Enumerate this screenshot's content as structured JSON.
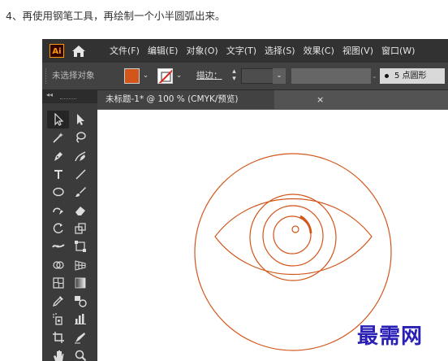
{
  "caption": "4、再使用钢笔工具，再绘制一个小半圆弧出来。",
  "app": {
    "logo": "Ai",
    "menu": [
      "文件(F)",
      "编辑(E)",
      "对象(O)",
      "文字(T)",
      "选择(S)",
      "效果(C)",
      "视图(V)",
      "窗口(W)"
    ],
    "control_bar": {
      "selection_label": "未选择对象",
      "fill_color": "#d2561b",
      "stroke_label": "描边：",
      "brush_label": "5 点圆形"
    },
    "toolbar": {
      "collapse_glyph": "◂◂",
      "tools": [
        {
          "name": "selection-tool-icon",
          "active": true
        },
        {
          "name": "direct-selection-tool-icon",
          "active": false
        },
        {
          "name": "magic-wand-tool-icon",
          "active": false
        },
        {
          "name": "lasso-tool-icon",
          "active": false
        },
        {
          "name": "pen-tool-icon",
          "active": false
        },
        {
          "name": "curvature-tool-icon",
          "active": false
        },
        {
          "name": "type-tool-icon",
          "active": false
        },
        {
          "name": "line-segment-tool-icon",
          "active": false
        },
        {
          "name": "ellipse-tool-icon",
          "active": false
        },
        {
          "name": "paintbrush-tool-icon",
          "active": false
        },
        {
          "name": "shaper-tool-icon",
          "active": false
        },
        {
          "name": "eraser-tool-icon",
          "active": false
        },
        {
          "name": "rotate-tool-icon",
          "active": false
        },
        {
          "name": "scale-tool-icon",
          "active": false
        },
        {
          "name": "width-tool-icon",
          "active": false
        },
        {
          "name": "free-transform-tool-icon",
          "active": false
        },
        {
          "name": "shape-builder-tool-icon",
          "active": false
        },
        {
          "name": "perspective-grid-tool-icon",
          "active": false
        },
        {
          "name": "mesh-tool-icon",
          "active": false
        },
        {
          "name": "gradient-tool-icon",
          "active": false
        },
        {
          "name": "eyedropper-tool-icon",
          "active": false
        },
        {
          "name": "blend-tool-icon",
          "active": false
        },
        {
          "name": "symbol-sprayer-tool-icon",
          "active": false
        },
        {
          "name": "column-graph-tool-icon",
          "active": false
        },
        {
          "name": "artboard-tool-icon",
          "active": false
        },
        {
          "name": "slice-tool-icon",
          "active": false
        },
        {
          "name": "hand-tool-icon",
          "active": false
        },
        {
          "name": "zoom-tool-icon",
          "active": false
        }
      ]
    },
    "document_tab": {
      "title": "未标题-1* @ 100 % (CMYK/预览)",
      "close": "×"
    },
    "artwork": {
      "stroke_color": "#d2561b"
    }
  },
  "watermark": "最需网"
}
